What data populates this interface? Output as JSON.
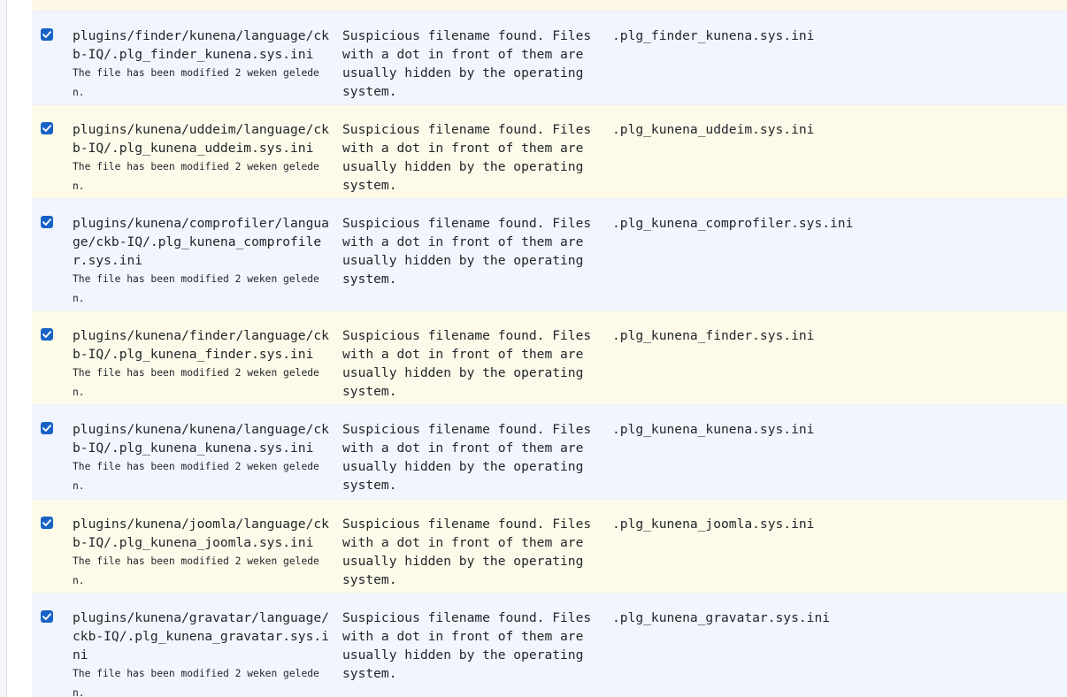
{
  "rows": [
    {
      "checked": true,
      "path": "plugins/finder/kunena/language/ckb-IQ/.plg_finder_kunena.sys.ini",
      "meta": "The file has been modified 2 weken geleden.",
      "description": "Suspicious filename found. Files with a dot in front of them are usually hidden by the operating system.",
      "filename": ".plg_finder_kunena.sys.ini"
    },
    {
      "checked": true,
      "path": "plugins/kunena/uddeim/language/ckb-IQ/.plg_kunena_uddeim.sys.ini",
      "meta": "The file has been modified 2 weken geleden.",
      "description": "Suspicious filename found. Files with a dot in front of them are usually hidden by the operating system.",
      "filename": ".plg_kunena_uddeim.sys.ini"
    },
    {
      "checked": true,
      "path": "plugins/kunena/comprofiler/language/ckb-IQ/.plg_kunena_comprofiler.sys.ini",
      "meta": "The file has been modified 2 weken geleden.",
      "description": "Suspicious filename found. Files with a dot in front of them are usually hidden by the operating system.",
      "filename": ".plg_kunena_comprofiler.sys.ini"
    },
    {
      "checked": true,
      "path": "plugins/kunena/finder/language/ckb-IQ/.plg_kunena_finder.sys.ini",
      "meta": "The file has been modified 2 weken geleden.",
      "description": "Suspicious filename found. Files with a dot in front of them are usually hidden by the operating system.",
      "filename": ".plg_kunena_finder.sys.ini"
    },
    {
      "checked": true,
      "path": "plugins/kunena/kunena/language/ckb-IQ/.plg_kunena_kunena.sys.ini",
      "meta": "The file has been modified 2 weken geleden.",
      "description": "Suspicious filename found. Files with a dot in front of them are usually hidden by the operating system.",
      "filename": ".plg_kunena_kunena.sys.ini"
    },
    {
      "checked": true,
      "path": "plugins/kunena/joomla/language/ckb-IQ/.plg_kunena_joomla.sys.ini",
      "meta": "The file has been modified 2 weken geleden.",
      "description": "Suspicious filename found. Files with a dot in front of them are usually hidden by the operating system.",
      "filename": ".plg_kunena_joomla.sys.ini"
    },
    {
      "checked": true,
      "path": "plugins/kunena/gravatar/language/ckb-IQ/.plg_kunena_gravatar.sys.ini",
      "meta": "The file has been modified 2 weken geleden.",
      "description": "Suspicious filename found. Files with a dot in front of them are usually hidden by the operating system.",
      "filename": ".plg_kunena_gravatar.sys.ini"
    }
  ],
  "colors": {
    "row_blue": "#f1f5fd",
    "row_cream": "#fdfae9",
    "checkbox": "#1862c6"
  },
  "icons": {
    "checkbox": "checkmark-icon"
  }
}
